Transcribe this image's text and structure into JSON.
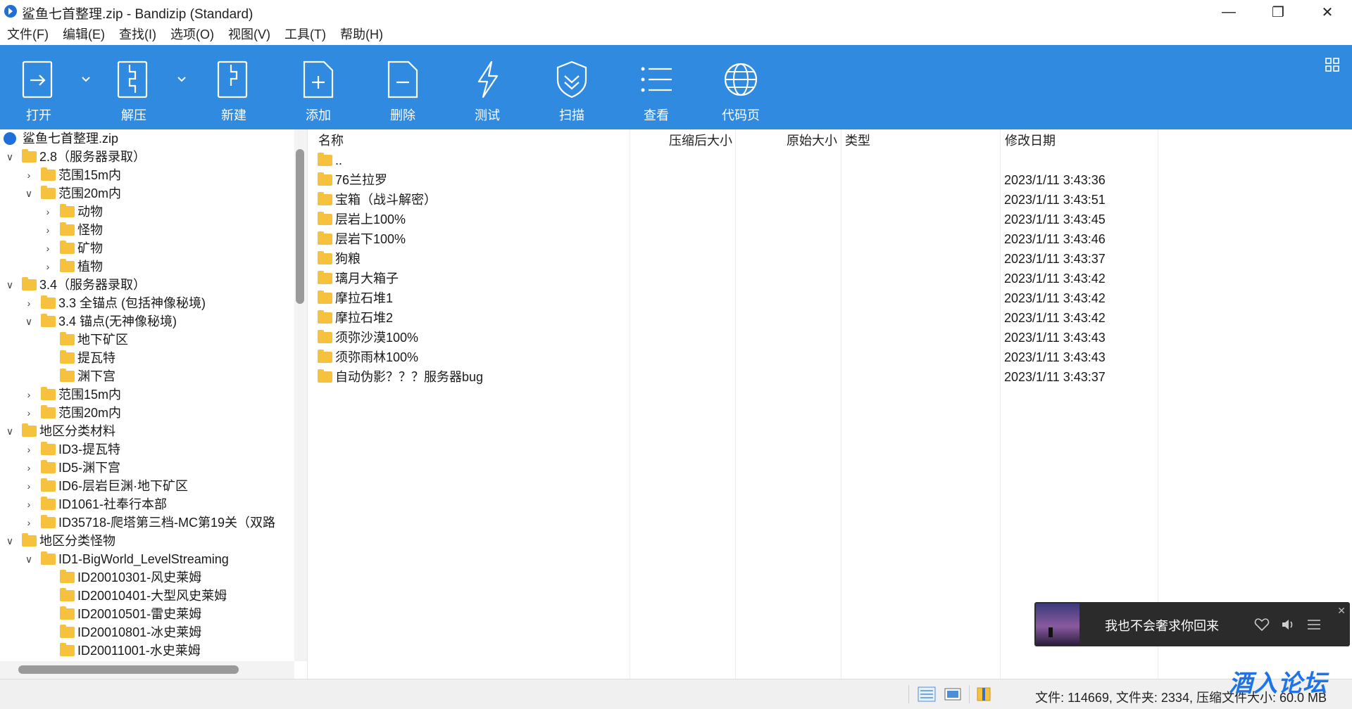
{
  "window": {
    "title": "鲨鱼七首整理.zip - Bandizip (Standard)",
    "minimize": "—",
    "maximize": "❐",
    "close": "✕"
  },
  "menu": [
    "文件(F)",
    "编辑(E)",
    "查找(I)",
    "选项(O)",
    "视图(V)",
    "工具(T)",
    "帮助(H)"
  ],
  "toolbar": {
    "open": "打开",
    "extract": "解压",
    "new": "新建",
    "add": "添加",
    "delete": "删除",
    "test": "测试",
    "scan": "扫描",
    "view": "查看",
    "codepage": "代码页"
  },
  "tree": [
    {
      "label": "鲨鱼七首整理.zip",
      "exp": "",
      "depth": 0,
      "root": true
    },
    {
      "label": "2.8（服务器录取）",
      "exp": "v",
      "depth": 0
    },
    {
      "label": "范围15m内",
      "exp": ">",
      "depth": 1
    },
    {
      "label": "范围20m内",
      "exp": "v",
      "depth": 1
    },
    {
      "label": "动物",
      "exp": ">",
      "depth": 2
    },
    {
      "label": "怪物",
      "exp": ">",
      "depth": 2
    },
    {
      "label": "矿物",
      "exp": ">",
      "depth": 2
    },
    {
      "label": "植物",
      "exp": ">",
      "depth": 2
    },
    {
      "label": "3.4（服务器录取）",
      "exp": "v",
      "depth": 0
    },
    {
      "label": "3.3 全锚点 (包括神像秘境)",
      "exp": ">",
      "depth": 1
    },
    {
      "label": "3.4 锚点(无神像秘境)",
      "exp": "v",
      "depth": 1
    },
    {
      "label": "地下矿区",
      "exp": "",
      "depth": 2
    },
    {
      "label": "提瓦特",
      "exp": "",
      "depth": 2
    },
    {
      "label": "渊下宫",
      "exp": "",
      "depth": 2
    },
    {
      "label": "范围15m内",
      "exp": ">",
      "depth": 1
    },
    {
      "label": "范围20m内",
      "exp": ">",
      "depth": 1
    },
    {
      "label": "地区分类材料",
      "exp": "v",
      "depth": 0
    },
    {
      "label": "ID3-提瓦特",
      "exp": ">",
      "depth": 1
    },
    {
      "label": "ID5-渊下宫",
      "exp": ">",
      "depth": 1
    },
    {
      "label": "ID6-层岩巨渊·地下矿区",
      "exp": ">",
      "depth": 1
    },
    {
      "label": "ID1061-社奉行本部",
      "exp": ">",
      "depth": 1
    },
    {
      "label": "ID35718-爬塔第三档-MC第19关（双路",
      "exp": ">",
      "depth": 1
    },
    {
      "label": "地区分类怪物",
      "exp": "v",
      "depth": 0
    },
    {
      "label": "ID1-BigWorld_LevelStreaming",
      "exp": "v",
      "depth": 1
    },
    {
      "label": "ID20010301-风史莱姆",
      "exp": "",
      "depth": 2
    },
    {
      "label": "ID20010401-大型风史莱姆",
      "exp": "",
      "depth": 2
    },
    {
      "label": "ID20010501-雷史莱姆",
      "exp": "",
      "depth": 2
    },
    {
      "label": "ID20010801-冰史莱姆",
      "exp": "",
      "depth": 2
    },
    {
      "label": "ID20011001-水史莱姆",
      "exp": "",
      "depth": 2
    }
  ],
  "columns": {
    "name": "名称",
    "packed": "压缩后大小",
    "original": "原始大小",
    "type": "类型",
    "modified": "修改日期"
  },
  "files": [
    {
      "name": "..",
      "date": ""
    },
    {
      "name": "76兰拉罗",
      "date": "2023/1/11 3:43:36"
    },
    {
      "name": "宝箱（战斗解密）",
      "date": "2023/1/11 3:43:51"
    },
    {
      "name": "层岩上100%",
      "date": "2023/1/11 3:43:45"
    },
    {
      "name": "层岩下100%",
      "date": "2023/1/11 3:43:46"
    },
    {
      "name": "狗粮",
      "date": "2023/1/11 3:43:37"
    },
    {
      "name": "璃月大箱子",
      "date": "2023/1/11 3:43:42"
    },
    {
      "name": "摩拉石堆1",
      "date": "2023/1/11 3:43:42"
    },
    {
      "name": "摩拉石堆2",
      "date": "2023/1/11 3:43:42"
    },
    {
      "name": "须弥沙漠100%",
      "date": "2023/1/11 3:43:43"
    },
    {
      "name": "须弥雨林100%",
      "date": "2023/1/11 3:43:43"
    },
    {
      "name": "自动伪影？？？服务器bug",
      "date": "2023/1/11 3:43:37"
    }
  ],
  "status": {
    "summary": "文件: 114669, 文件夹: 2334, 压缩文件大小: 60.0 MB"
  },
  "music": {
    "song": "我也不会奢求你回来",
    "close": "✕"
  },
  "watermark": "酒入论坛",
  "colors": {
    "toolbar": "#2f8ae0",
    "folder": "#f6c13c"
  }
}
